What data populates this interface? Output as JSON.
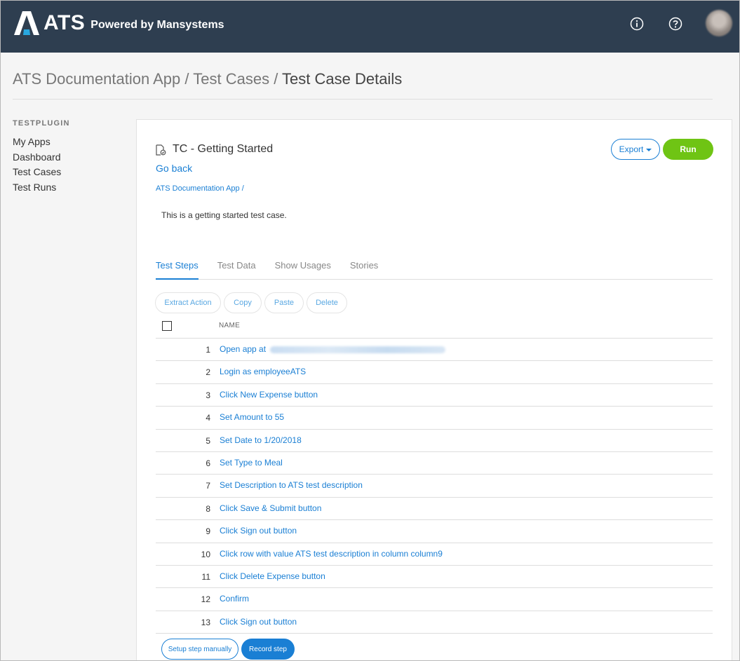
{
  "header": {
    "logo_text": "ATS",
    "logo_sub": "Powered by Mansystems",
    "info_icon": "info-circle-icon",
    "help_icon": "question-circle-icon",
    "bg_color": "#2e3e50"
  },
  "breadcrumb": {
    "part1": "ATS Documentation App",
    "sep1": " / ",
    "part2": "Test Cases",
    "sep2": " / ",
    "current": "Test Case Details"
  },
  "sidebar": {
    "heading": "TESTPLUGIN",
    "items": [
      {
        "label": "My Apps"
      },
      {
        "label": "Dashboard"
      },
      {
        "label": "Test Cases"
      },
      {
        "label": "Test Runs"
      }
    ]
  },
  "testcase": {
    "title": "TC - Getting Started",
    "go_back": "Go back",
    "crumb": "ATS Documentation App /",
    "description": "This is a getting started test case.",
    "export_label": "Export",
    "run_label": "Run",
    "run_color": "#6fc414",
    "link_color": "#1a7fd4"
  },
  "tabs": [
    {
      "label": "Test Steps",
      "active": true
    },
    {
      "label": "Test Data",
      "active": false
    },
    {
      "label": "Show Usages",
      "active": false
    },
    {
      "label": "Stories",
      "active": false
    }
  ],
  "toolbar": {
    "extract": "Extract Action",
    "copy": "Copy",
    "paste": "Paste",
    "delete": "Delete"
  },
  "table": {
    "name_header": "NAME",
    "rows": [
      {
        "num": "1",
        "name": "Open app at"
      },
      {
        "num": "2",
        "name": "Login as employeeATS"
      },
      {
        "num": "3",
        "name": "Click New Expense button"
      },
      {
        "num": "4",
        "name": "Set Amount to 55"
      },
      {
        "num": "5",
        "name": "Set Date to 1/20/2018"
      },
      {
        "num": "6",
        "name": "Set Type to Meal"
      },
      {
        "num": "7",
        "name": "Set Description to ATS test description"
      },
      {
        "num": "8",
        "name": "Click Save & Submit button"
      },
      {
        "num": "9",
        "name": "Click Sign out button"
      },
      {
        "num": "10",
        "name": "Click row with value ATS test description in column column9"
      },
      {
        "num": "11",
        "name": "Click Delete Expense button"
      },
      {
        "num": "12",
        "name": "Confirm"
      },
      {
        "num": "13",
        "name": "Click Sign out button"
      }
    ]
  },
  "footer_buttons": {
    "manual": "Setup step manually",
    "record": "Record step"
  }
}
